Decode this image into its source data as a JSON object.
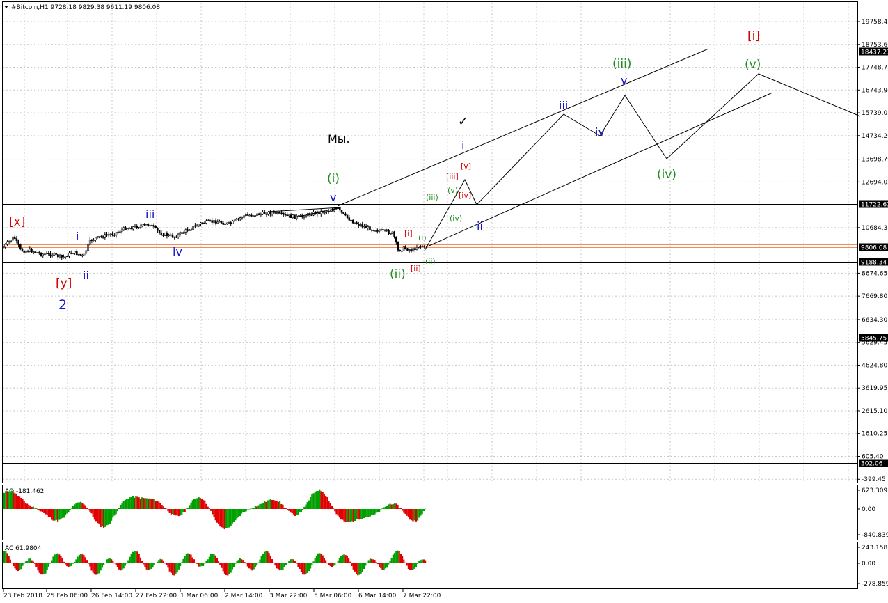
{
  "window": {
    "symbol_title": "#Bitcoin,H1  9728.18 9829.38 9611.19 9806.08",
    "menu_arrow_icon": "triangle-down-icon"
  },
  "colors": {
    "red": "#d60000",
    "green": "#1e8c1e",
    "blue": "#1414c8",
    "black": "#000000",
    "bull": "#00a000",
    "bear": "#e00000",
    "price_line": "#f08c5a"
  },
  "price_axis": {
    "ticks": [
      "19758.45",
      "18753.60",
      "17748.75",
      "16743.90",
      "15739.05",
      "14734.20",
      "13698.70",
      "12694.05",
      "10684.35",
      "8674.65",
      "7669.80",
      "6634.30",
      "5629.45",
      "4624.80",
      "3619.95",
      "2615.10",
      "1610.25",
      "605.40",
      "-399.45"
    ],
    "level_boxes": [
      {
        "value": "18437.21"
      },
      {
        "value": "11722.63"
      },
      {
        "value": "9806.08"
      },
      {
        "value": "9188.34"
      },
      {
        "value": "5845.75"
      },
      {
        "value": "302.06"
      }
    ],
    "current_price": "9806.08",
    "hidden_price": "9956.99"
  },
  "time_axis": {
    "labels": [
      "23 Feb 2018",
      "25 Feb 06:00",
      "26 Feb 14:00",
      "27 Feb 22:00",
      "1 Mar 06:00",
      "2 Mar 14:00",
      "3 Mar 22:00",
      "5 Mar 06:00",
      "6 Mar 14:00",
      "7 Mar 22:00"
    ]
  },
  "annotations": {
    "note_text": "Мы.",
    "checkmark": "✓",
    "waves": [
      {
        "text": "[x]",
        "color": "red"
      },
      {
        "text": "[y]",
        "color": "red"
      },
      {
        "text": "2",
        "color": "blue"
      },
      {
        "text": "i",
        "color": "blue"
      },
      {
        "text": "ii",
        "color": "blue"
      },
      {
        "text": "iii",
        "color": "blue"
      },
      {
        "text": "iv",
        "color": "blue"
      },
      {
        "text": "(i)",
        "color": "green"
      },
      {
        "text": "v",
        "color": "blue"
      },
      {
        "text": "(ii)",
        "color": "green"
      },
      {
        "text": "[i]",
        "color": "red"
      },
      {
        "text": "[ii]",
        "color": "red"
      },
      {
        "text": "(i)",
        "color": "green"
      },
      {
        "text": "(ii)",
        "color": "green"
      },
      {
        "text": "(iii)",
        "color": "green"
      },
      {
        "text": "(iv)",
        "color": "green"
      },
      {
        "text": "(v)",
        "color": "green"
      },
      {
        "text": "[iii]",
        "color": "red"
      },
      {
        "text": "[iv]",
        "color": "red"
      },
      {
        "text": "[v]",
        "color": "red"
      },
      {
        "text": "i",
        "color": "blue"
      },
      {
        "text": "ii",
        "color": "blue"
      },
      {
        "text": "iii",
        "color": "blue"
      },
      {
        "text": "iv",
        "color": "blue"
      },
      {
        "text": "v",
        "color": "blue"
      },
      {
        "text": "(iii)",
        "color": "green"
      },
      {
        "text": "(iv)",
        "color": "green"
      },
      {
        "text": "(v)",
        "color": "green"
      },
      {
        "text": "[i]",
        "color": "red"
      }
    ]
  },
  "ao_panel": {
    "label": "AO -181.462",
    "ticks": [
      "623.309",
      "0.00",
      "-840.839"
    ]
  },
  "ac_panel": {
    "label": "AC 61.9804",
    "ticks": [
      "243.1586",
      "0.00",
      "-278.8593"
    ]
  }
}
